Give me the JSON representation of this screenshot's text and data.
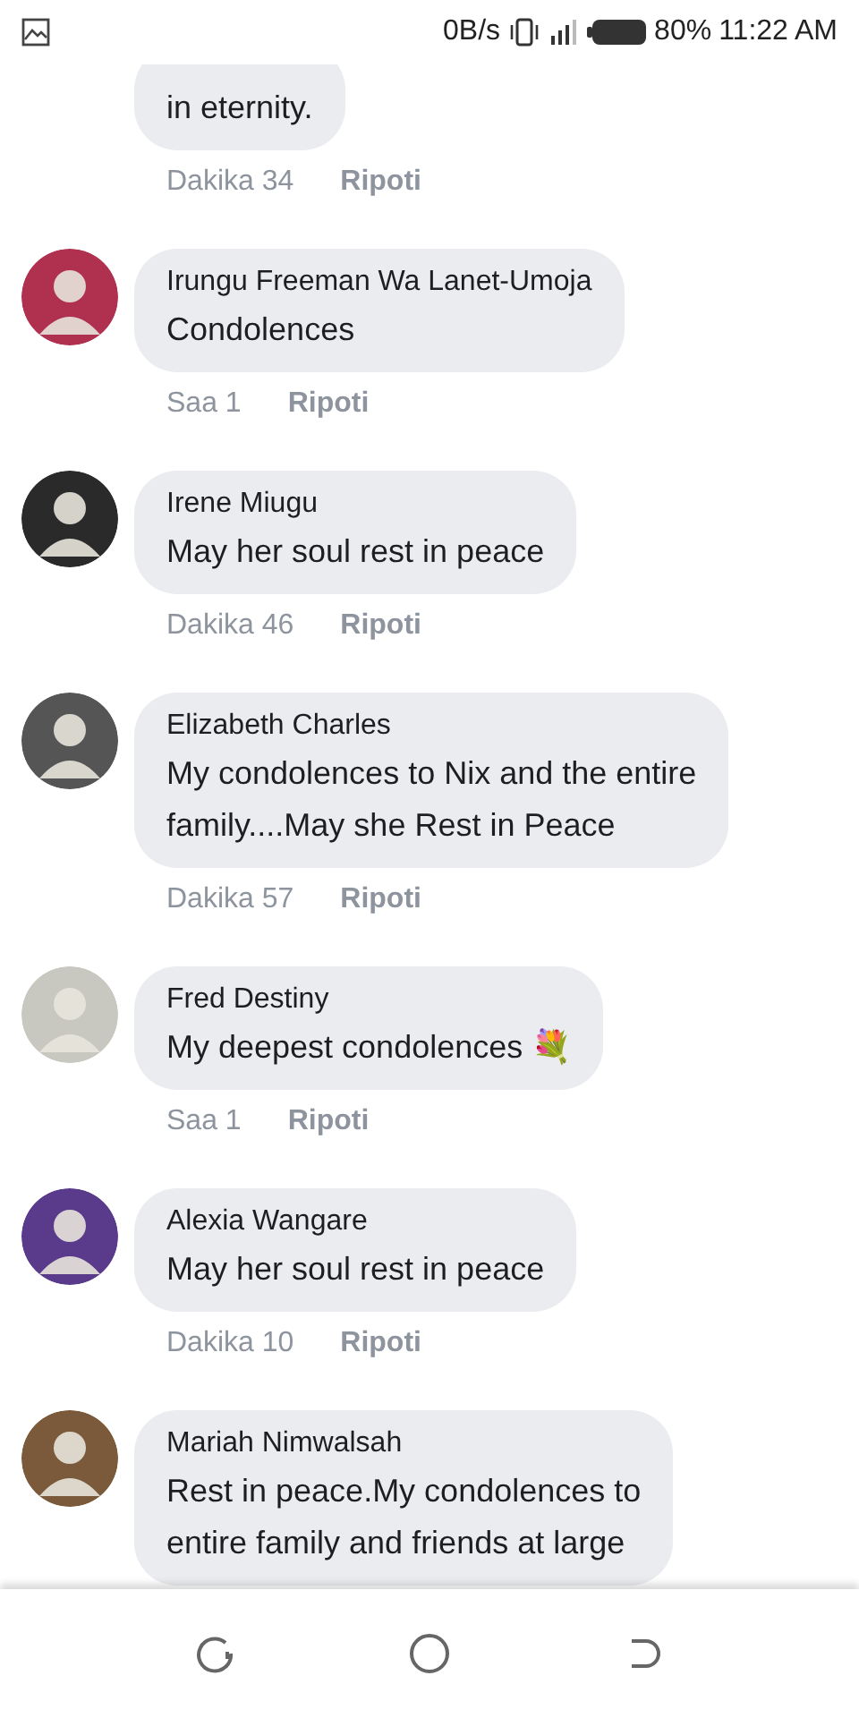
{
  "status_bar": {
    "speed": "0B/s",
    "battery": "80%",
    "time": "11:22 AM"
  },
  "comments": [
    {
      "text_lines": [
        "in eternity."
      ],
      "time": "Dakika 34",
      "report": "Ripoti"
    },
    {
      "author": "Irungu Freeman Wa Lanet-Umoja",
      "text_lines": [
        "Condolences"
      ],
      "time": "Saa 1",
      "report": "Ripoti"
    },
    {
      "author": "Irene Miugu",
      "text_lines": [
        "May her soul rest in peace"
      ],
      "time": "Dakika 46",
      "report": "Ripoti"
    },
    {
      "author": "Elizabeth Charles",
      "text_lines": [
        "My condolences to Nix and the entire",
        "family....May she Rest in Peace"
      ],
      "time": "Dakika 57",
      "report": "Ripoti"
    },
    {
      "author": "Fred Destiny",
      "text_lines": [
        "My deepest condolences 💐"
      ],
      "time": "Saa 1",
      "report": "Ripoti"
    },
    {
      "author": "Alexia Wangare",
      "text_lines": [
        "May her soul rest in peace"
      ],
      "time": "Dakika 10",
      "report": "Ripoti"
    },
    {
      "author": "Mariah Nimwalsah",
      "text_lines": [
        "Rest in peace.My condolences to",
        "entire family and friends at large"
      ]
    }
  ]
}
